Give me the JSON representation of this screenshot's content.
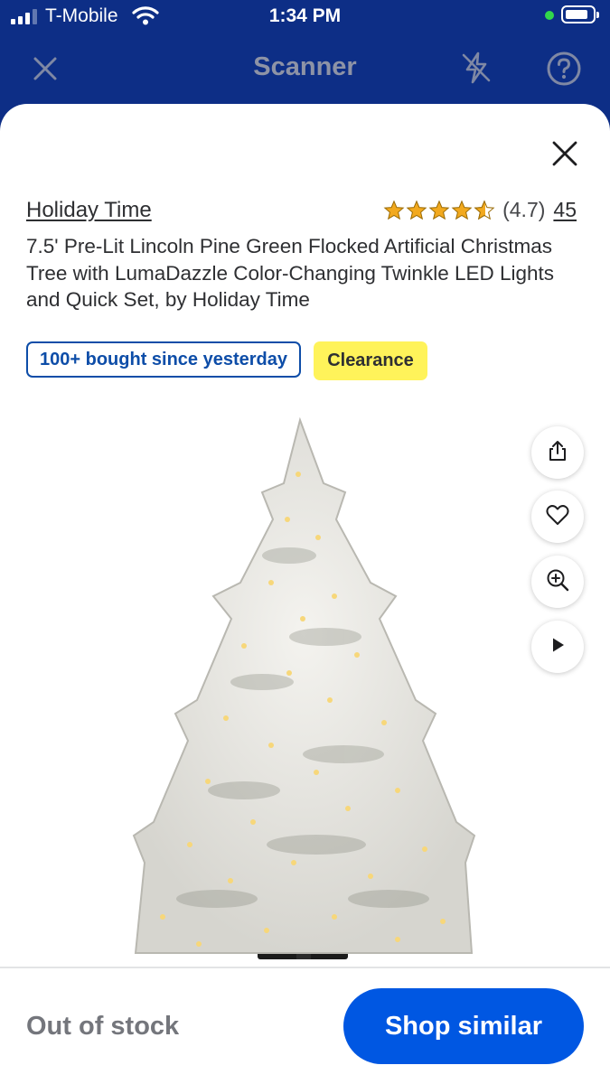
{
  "status_bar": {
    "carrier": "T-Mobile",
    "time": "1:34 PM"
  },
  "header": {
    "title": "Scanner",
    "icons": [
      "close-icon",
      "flash-off-icon",
      "help-icon"
    ]
  },
  "product": {
    "brand": "Holiday Time",
    "rating_value": 4.7,
    "rating_text": "(4.7)",
    "review_count": "45",
    "title": "7.5' Pre-Lit Lincoln Pine Green Flocked Artificial Christmas Tree with LumaDazzle Color-Changing Twinkle LED Lights and Quick Set, by Holiday Time",
    "badges": {
      "bought": "100+ bought since yesterday",
      "clearance": "Clearance"
    }
  },
  "image_actions": [
    "share-icon",
    "heart-icon",
    "zoom-in-icon",
    "play-icon"
  ],
  "footer": {
    "stock_status": "Out of stock",
    "cta_label": "Shop similar"
  },
  "colors": {
    "header_bg": "#0d2e86",
    "primary_button": "#0057e2",
    "clearance_badge": "#fff35a",
    "badge_outline": "#0d4da8",
    "star": "#f2a91e"
  }
}
